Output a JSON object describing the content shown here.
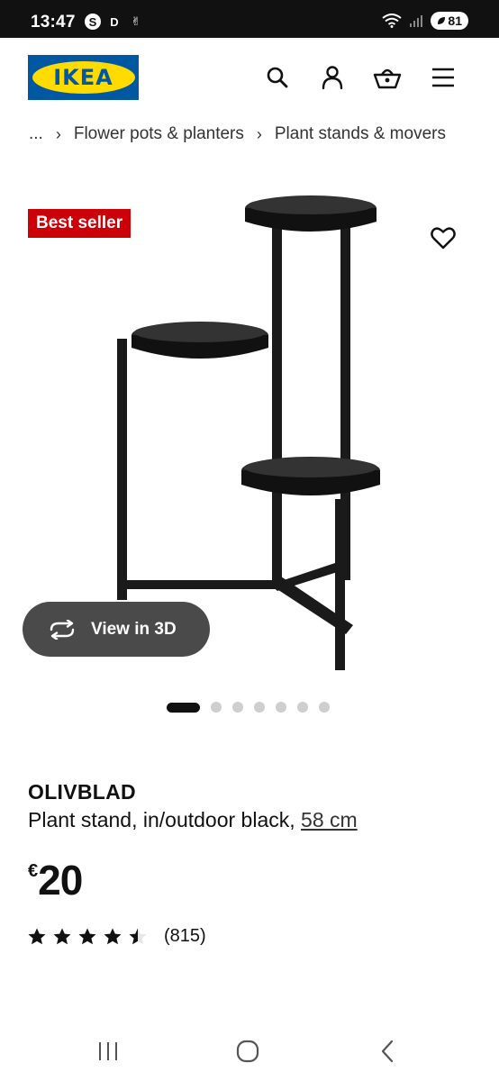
{
  "status_bar": {
    "time": "13:47",
    "left_icons": [
      "S",
      "D",
      "✌"
    ],
    "battery": "81"
  },
  "header": {
    "logo_text": "IKEA",
    "icons": [
      "search-icon",
      "profile-icon",
      "basket-icon",
      "menu-icon"
    ]
  },
  "breadcrumb": {
    "ellipsis": "...",
    "items": [
      "Flower pots & planters",
      "Plant stands & movers"
    ]
  },
  "media": {
    "badge": "Best seller",
    "view_3d_label": "View in 3D",
    "slides_total": 7,
    "slide_active": 1
  },
  "product": {
    "name": "OLIVBLAD",
    "description": "Plant stand, in/outdoor black, ",
    "size": "58 cm",
    "currency": "€",
    "price": "20",
    "rating_value": 4.6,
    "rating_max": 5,
    "reviews": "(815)"
  },
  "colors": {
    "ikea_blue": "#0058a3",
    "ikea_yellow": "#ffdb00",
    "badge_red": "#cc0008"
  }
}
